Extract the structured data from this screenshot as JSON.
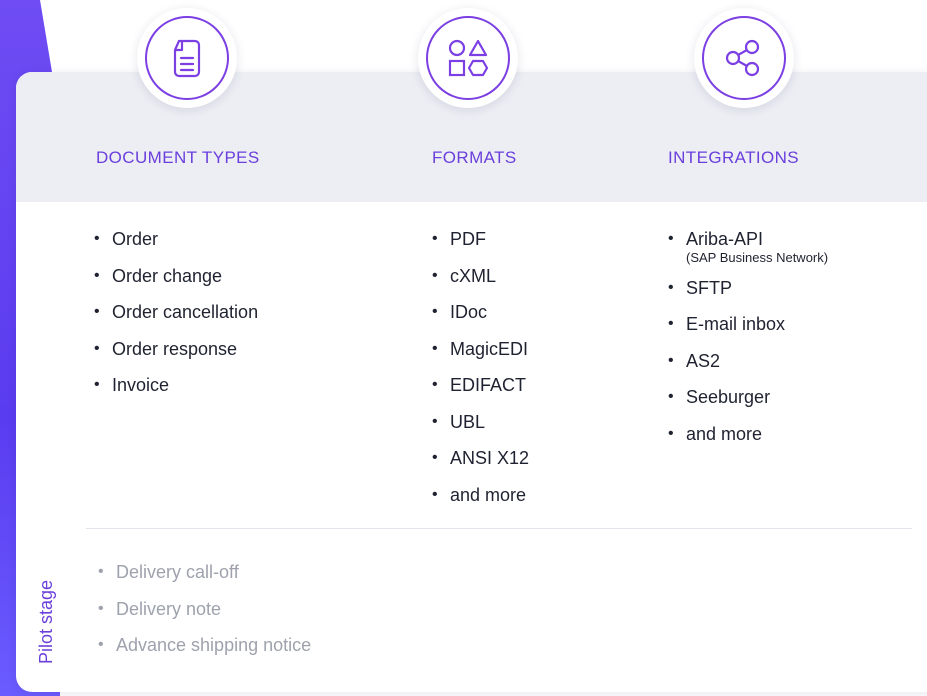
{
  "colors": {
    "accent": "#6a3fdc",
    "band": "#eceef4",
    "text": "#1f2230",
    "muted": "#9ea2ad"
  },
  "columns": [
    {
      "heading": "DOCUMENT TYPES",
      "icon": "document-icon",
      "items": [
        "Order",
        "Order change",
        "Order cancellation",
        "Order response",
        "Invoice"
      ]
    },
    {
      "heading": "FORMATS",
      "icon": "shapes-icon",
      "items": [
        "PDF",
        "cXML",
        "IDoc",
        "MagicEDI",
        "EDIFACT",
        "UBL",
        "ANSI X12",
        "and more"
      ]
    },
    {
      "heading": "INTEGRATIONS",
      "icon": "share-icon",
      "items": [
        "Ariba-API",
        "SFTP",
        "E-mail inbox",
        "AS2",
        "Seeburger",
        "and more"
      ],
      "item_note": "(SAP Business Network)"
    }
  ],
  "pilot": {
    "label": "Pilot stage",
    "items": [
      "Delivery call-off",
      "Delivery note",
      "Advance shipping notice"
    ]
  }
}
